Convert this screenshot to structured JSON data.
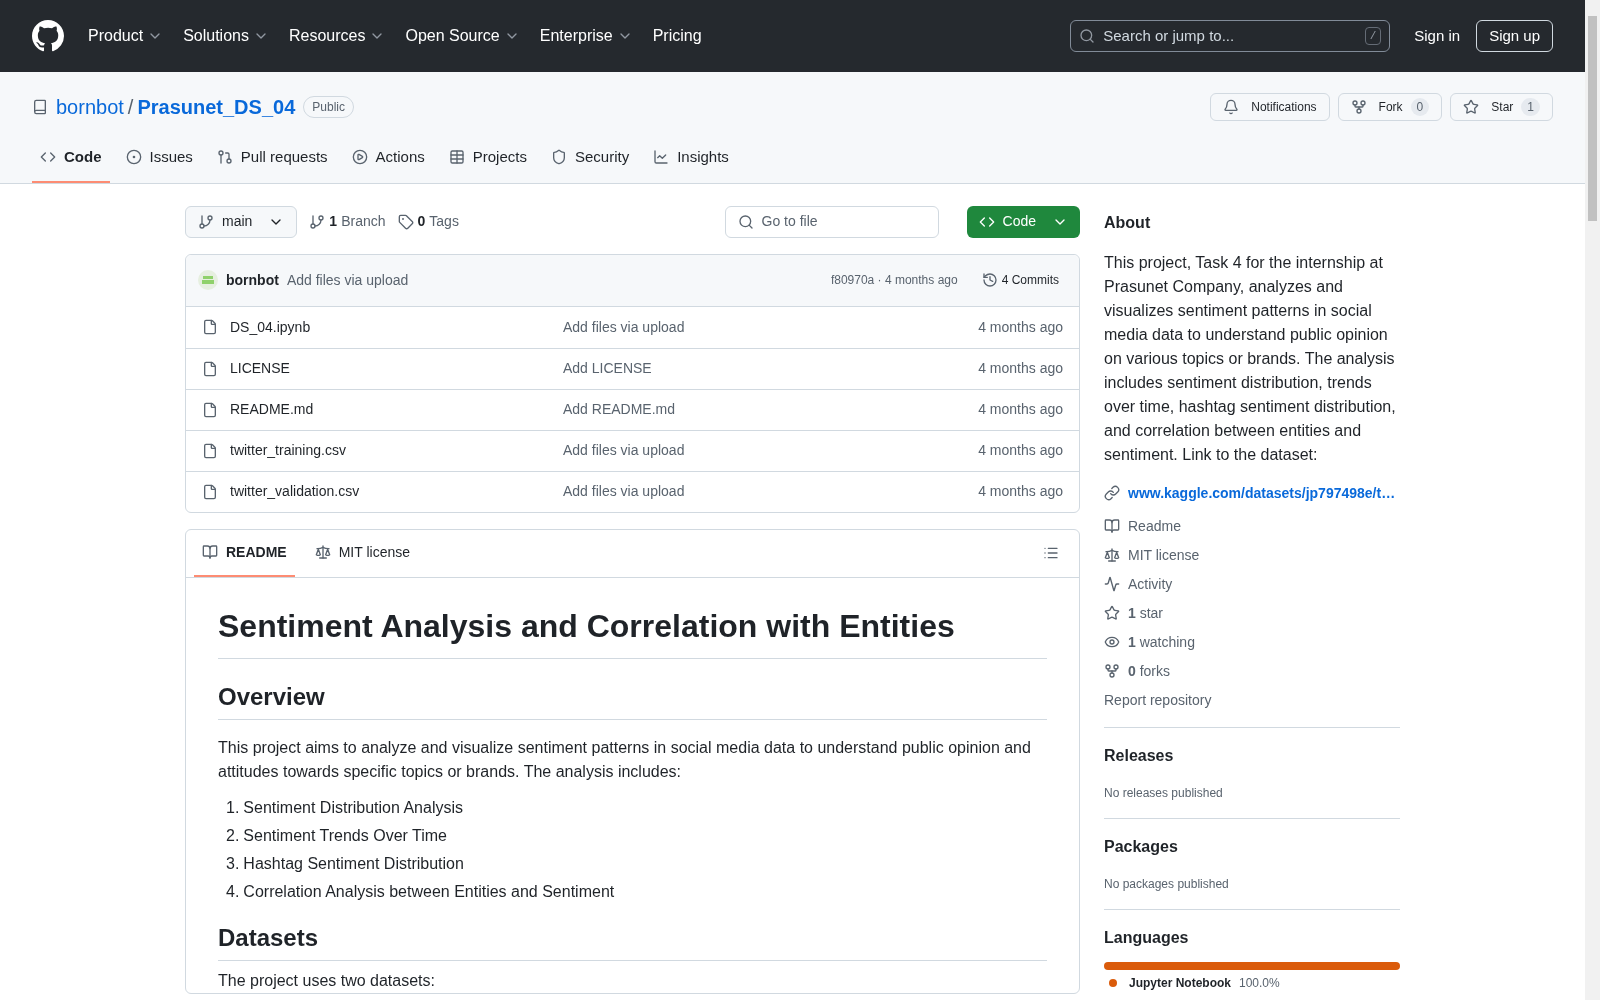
{
  "header": {
    "nav": [
      {
        "label": "Product",
        "dropdown": true
      },
      {
        "label": "Solutions",
        "dropdown": true
      },
      {
        "label": "Resources",
        "dropdown": true
      },
      {
        "label": "Open Source",
        "dropdown": true
      },
      {
        "label": "Enterprise",
        "dropdown": true
      },
      {
        "label": "Pricing",
        "dropdown": false
      }
    ],
    "search": {
      "placeholder": "Search or jump to...",
      "shortcut": "/"
    },
    "sign_in": "Sign in",
    "sign_up": "Sign up"
  },
  "repo": {
    "owner": "bornbot",
    "separator": "/",
    "name": "Prasunet_DS_04",
    "visibility": "Public",
    "actions": [
      {
        "kind": "notifications",
        "label": "Notifications"
      },
      {
        "kind": "fork",
        "label": "Fork",
        "count": "0"
      },
      {
        "kind": "star",
        "label": "Star",
        "count": "1"
      }
    ],
    "tabs": [
      {
        "kind": "code",
        "label": "Code",
        "selected": true
      },
      {
        "kind": "issues",
        "label": "Issues",
        "selected": false
      },
      {
        "kind": "pulls",
        "label": "Pull requests",
        "selected": false
      },
      {
        "kind": "actions",
        "label": "Actions",
        "selected": false
      },
      {
        "kind": "projects",
        "label": "Projects",
        "selected": false
      },
      {
        "kind": "security",
        "label": "Security",
        "selected": false
      },
      {
        "kind": "insights",
        "label": "Insights",
        "selected": false
      }
    ]
  },
  "toolbar": {
    "branch": "main",
    "branch_count": "1",
    "branch_label": "Branch",
    "tag_count": "0",
    "tag_label": "Tags",
    "go_to_file": {
      "placeholder": "Go to file"
    },
    "code_button": "Code"
  },
  "commit": {
    "author": "bornbot",
    "message": "Add files via upload",
    "hash_time": "f80970a · 4 months ago",
    "commits": "4 Commits"
  },
  "files": [
    {
      "name": "DS_04.ipynb",
      "message": "Add files via upload",
      "time": "4 months ago"
    },
    {
      "name": "LICENSE",
      "message": "Add LICENSE",
      "time": "4 months ago"
    },
    {
      "name": "README.md",
      "message": "Add README.md",
      "time": "4 months ago"
    },
    {
      "name": "twitter_training.csv",
      "message": "Add files via upload",
      "time": "4 months ago"
    },
    {
      "name": "twitter_validation.csv",
      "message": "Add files via upload",
      "time": "4 months ago"
    }
  ],
  "readme": {
    "tabs": [
      {
        "kind": "readme",
        "label": "README",
        "selected": true
      },
      {
        "kind": "license",
        "label": "MIT license",
        "selected": false
      }
    ],
    "title": "Sentiment Analysis and Correlation with Entities",
    "overview_heading": "Overview",
    "overview_text": "This project aims to analyze and visualize sentiment patterns in social media data to understand public opinion and attitudes towards specific topics or brands. The analysis includes:",
    "list": [
      {
        "number": "1.",
        "text": "Sentiment Distribution Analysis"
      },
      {
        "number": "2.",
        "text": "Sentiment Trends Over Time"
      },
      {
        "number": "3.",
        "text": "Hashtag Sentiment Distribution"
      },
      {
        "number": "4.",
        "text": "Correlation Analysis between Entities and Sentiment"
      }
    ],
    "datasets_heading": "Datasets",
    "datasets_text": "The project uses two datasets:"
  },
  "about": {
    "heading": "About",
    "description": "This project, Task 4 for the internship at Prasunet Company, analyzes and visualizes sentiment patterns in social media data to understand public opinion on various topics or brands. The analysis includes sentiment distribution, trends over time, hashtag sentiment distribution, and correlation between entities and sentiment. Link to the dataset:",
    "link": "www.kaggle.com/datasets/jp797498e/t…",
    "stats": [
      {
        "kind": "readme",
        "label": "Readme"
      },
      {
        "kind": "license",
        "label": "MIT license"
      },
      {
        "kind": "activity",
        "label": "Activity"
      },
      {
        "kind": "star",
        "count": "1",
        "label": "star"
      },
      {
        "kind": "watch",
        "count": "1",
        "label": "watching"
      },
      {
        "kind": "fork",
        "count": "0",
        "label": "forks"
      }
    ],
    "report": "Report repository"
  },
  "releases": {
    "heading": "Releases",
    "text": "No releases published"
  },
  "packages": {
    "heading": "Packages",
    "text": "No packages published"
  },
  "languages": {
    "heading": "Languages",
    "items": [
      {
        "name": "Jupyter Notebook",
        "percent": "100.0%",
        "color": "#da5b0b",
        "level": 1
      }
    ]
  }
}
